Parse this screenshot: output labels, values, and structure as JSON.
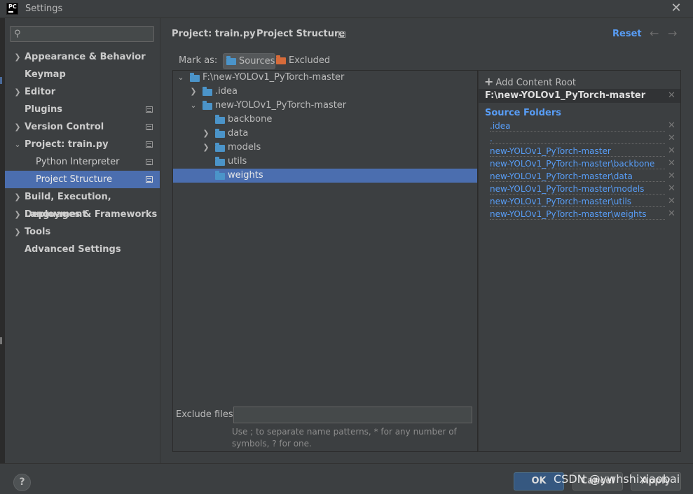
{
  "window": {
    "title": "Settings",
    "logo_text": "PC"
  },
  "sidebar": {
    "search_placeholder": "",
    "items": [
      {
        "label": "Appearance & Behavior",
        "expanded": false
      },
      {
        "label": "Keymap"
      },
      {
        "label": "Editor",
        "expanded": false
      },
      {
        "label": "Plugins"
      },
      {
        "label": "Version Control",
        "expanded": false
      },
      {
        "label": "Project: train.py",
        "expanded": true
      },
      {
        "label": "Python Interpreter"
      },
      {
        "label": "Project Structure",
        "selected": true
      },
      {
        "label": "Build, Execution, Deployment",
        "expanded": false
      },
      {
        "label": "Languages & Frameworks",
        "expanded": false
      },
      {
        "label": "Tools",
        "expanded": false
      },
      {
        "label": "Advanced Settings"
      }
    ]
  },
  "header": {
    "breadcrumb": [
      "Project: train.py",
      "Project Structure"
    ],
    "breadcrumb_separator": "›",
    "reset_label": "Reset"
  },
  "mark_as": {
    "label": "Mark as:",
    "sources_label": "Sources",
    "excluded_label": "Excluded"
  },
  "tree": {
    "nodes": [
      {
        "name": "F:\\new-YOLOv1_PyTorch-master",
        "expanded": true
      },
      {
        "name": ".idea",
        "expanded": false
      },
      {
        "name": "new-YOLOv1_PyTorch-master",
        "expanded": true
      },
      {
        "name": "backbone"
      },
      {
        "name": "data"
      },
      {
        "name": "models",
        "expanded": false
      },
      {
        "name": "utils"
      },
      {
        "name": "weights",
        "selected": true
      }
    ]
  },
  "exclude": {
    "label": "Exclude files:",
    "value": "",
    "hint": "Use ; to separate name patterns, * for any number of symbols, ? for one."
  },
  "content_roots": {
    "add_label": "Add Content Root",
    "root": "F:\\new-YOLOv1_PyTorch-master",
    "source_folders_title": "Source Folders",
    "source_folders": [
      ".idea",
      ".",
      "new-YOLOv1_PyTorch-master",
      "new-YOLOv1_PyTorch-master\\backbone",
      "new-YOLOv1_PyTorch-master\\data",
      "new-YOLOv1_PyTorch-master\\models",
      "new-YOLOv1_PyTorch-master\\utils",
      "new-YOLOv1_PyTorch-master\\weights"
    ]
  },
  "footer": {
    "help_label": "?",
    "ok_label": "OK",
    "cancel_label": "Cancel",
    "apply_label": "Apply",
    "watermark": "CSDN @ywhshixiaobai"
  },
  "colors": {
    "selection": "#4b6eaf",
    "link_blue": "#589df6",
    "folder_blue": "#4b94c9",
    "folder_orange": "#d66b3a"
  }
}
